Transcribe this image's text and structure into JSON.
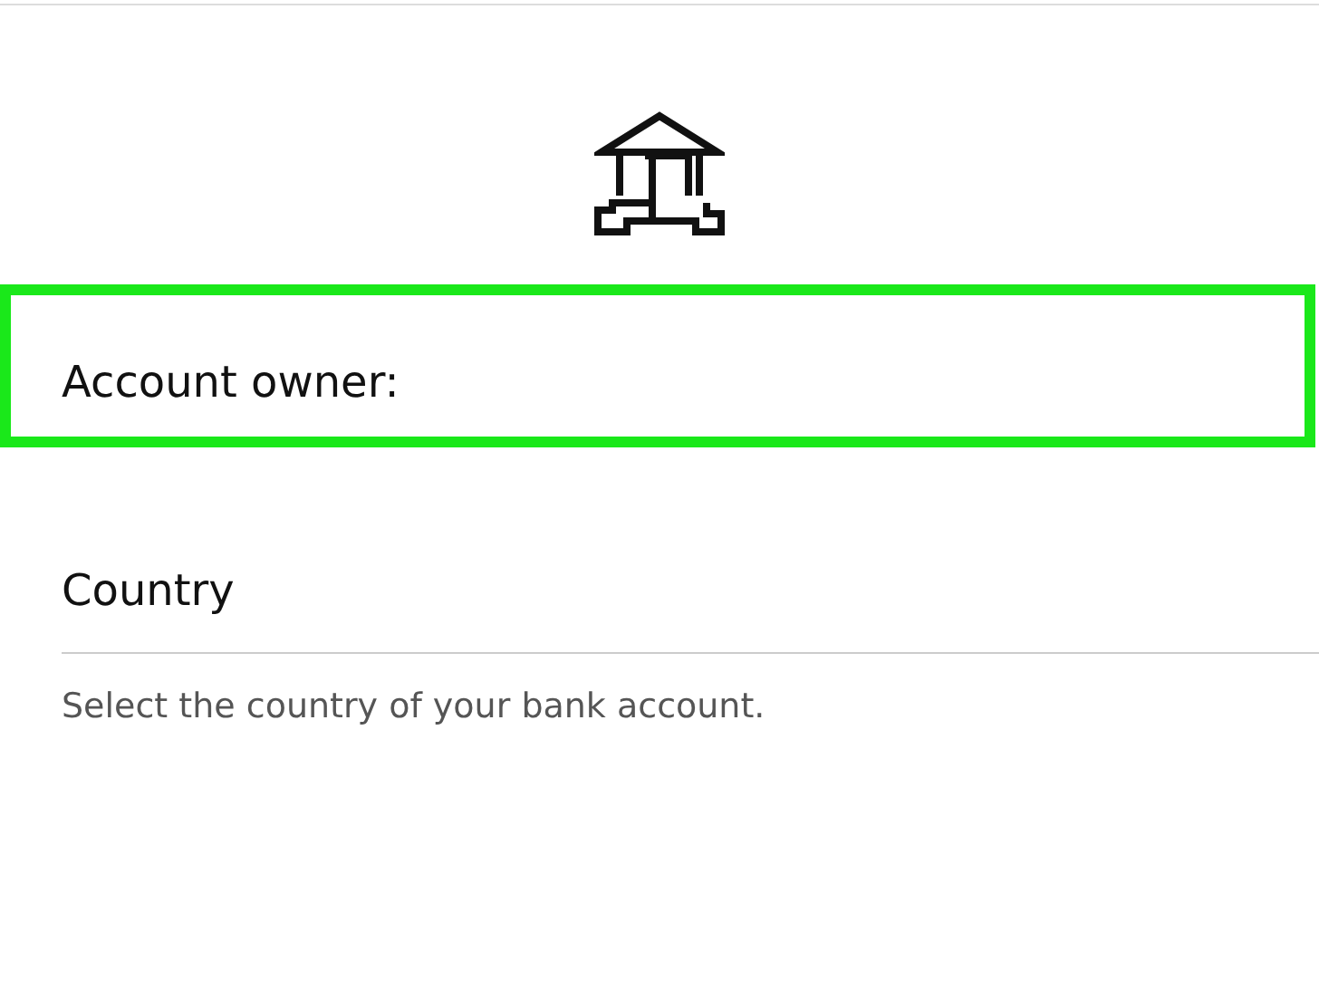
{
  "account_owner": {
    "label": "Account owner:",
    "highlighted": true
  },
  "country": {
    "label": "Country",
    "hint": "Select the country of your bank account."
  }
}
